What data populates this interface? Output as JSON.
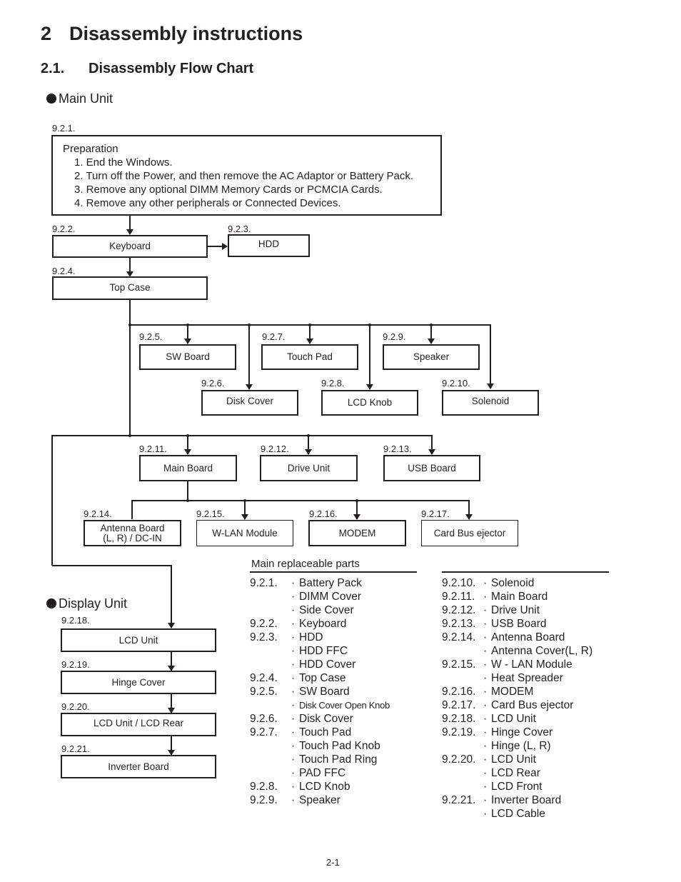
{
  "headings": {
    "chapter_number": "2",
    "chapter_title": "Disassembly instructions",
    "section_number": "2.1.",
    "section_title": "Disassembly Flow Chart",
    "main_unit": "Main Unit",
    "display_unit": "Display Unit"
  },
  "preparation": {
    "ref": "9.2.1.",
    "title": "Preparation",
    "steps": [
      "1. End the Windows.",
      "2. Turn off the Power, and then remove the AC Adaptor or Battery Pack.",
      "3. Remove any optional DIMM Memory Cards or PCMCIA Cards.",
      "4. Remove any other peripherals or Connected Devices."
    ]
  },
  "flow_nodes": [
    {
      "ref": "9.2.2.",
      "label": "Keyboard"
    },
    {
      "ref": "9.2.3.",
      "label": "HDD"
    },
    {
      "ref": "9.2.4.",
      "label": "Top Case"
    },
    {
      "ref": "9.2.5.",
      "label": "SW Board"
    },
    {
      "ref": "9.2.6.",
      "label": "Disk Cover"
    },
    {
      "ref": "9.2.7.",
      "label": "Touch Pad"
    },
    {
      "ref": "9.2.8.",
      "label": "LCD Knob"
    },
    {
      "ref": "9.2.9.",
      "label": "Speaker"
    },
    {
      "ref": "9.2.10.",
      "label": "Solenoid"
    },
    {
      "ref": "9.2.11.",
      "label": "Main Board"
    },
    {
      "ref": "9.2.12.",
      "label": "Drive Unit"
    },
    {
      "ref": "9.2.13.",
      "label": "USB Board"
    },
    {
      "ref": "9.2.14.",
      "label": "Antenna Board",
      "label2": "(L, R) / DC-IN"
    },
    {
      "ref": "9.2.15.",
      "label": "W-LAN Module"
    },
    {
      "ref": "9.2.16.",
      "label": "MODEM"
    },
    {
      "ref": "9.2.17.",
      "label": "Card Bus ejector"
    },
    {
      "ref": "9.2.18.",
      "label": "LCD Unit"
    },
    {
      "ref": "9.2.19.",
      "label": "Hinge Cover"
    },
    {
      "ref": "9.2.20.",
      "label": "LCD Unit / LCD Rear"
    },
    {
      "ref": "9.2.21.",
      "label": "Inverter Board"
    }
  ],
  "parts": {
    "heading": "Main replaceable parts",
    "bullet": "·",
    "left": [
      {
        "ref": "9.2.1.",
        "name": "Battery Pack"
      },
      {
        "ref": "",
        "name": "DIMM Cover"
      },
      {
        "ref": "",
        "name": "Side Cover"
      },
      {
        "ref": "9.2.2.",
        "name": "Keyboard"
      },
      {
        "ref": "9.2.3.",
        "name": "HDD"
      },
      {
        "ref": "",
        "name": "HDD FFC"
      },
      {
        "ref": "",
        "name": "HDD Cover"
      },
      {
        "ref": "9.2.4.",
        "name": "Top Case"
      },
      {
        "ref": "9.2.5.",
        "name": "SW Board"
      },
      {
        "ref": "",
        "name": "Disk Cover Open Knob",
        "small": true
      },
      {
        "ref": "9.2.6.",
        "name": "Disk Cover"
      },
      {
        "ref": "9.2.7.",
        "name": "Touch Pad"
      },
      {
        "ref": "",
        "name": "Touch Pad Knob"
      },
      {
        "ref": "",
        "name": "Touch Pad Ring"
      },
      {
        "ref": "",
        "name": "PAD FFC"
      },
      {
        "ref": "9.2.8.",
        "name": "LCD Knob"
      },
      {
        "ref": "9.2.9.",
        "name": "Speaker"
      }
    ],
    "right": [
      {
        "ref": "9.2.10.",
        "name": "Solenoid"
      },
      {
        "ref": "9.2.11.",
        "name": "Main Board"
      },
      {
        "ref": "9.2.12.",
        "name": "Drive Unit"
      },
      {
        "ref": "9.2.13.",
        "name": "USB Board"
      },
      {
        "ref": "9.2.14.",
        "name": "Antenna Board"
      },
      {
        "ref": "",
        "name": "Antenna Cover(L, R)"
      },
      {
        "ref": "9.2.15.",
        "name": "W - LAN Module"
      },
      {
        "ref": "",
        "name": "Heat Spreader"
      },
      {
        "ref": "9.2.16.",
        "name": "MODEM"
      },
      {
        "ref": "9.2.17.",
        "name": "Card Bus ejector"
      },
      {
        "ref": "9.2.18.",
        "name": "LCD Unit"
      },
      {
        "ref": "9.2.19.",
        "name": "Hinge Cover"
      },
      {
        "ref": "",
        "name": "Hinge (L, R)"
      },
      {
        "ref": "9.2.20.",
        "name": "LCD Unit"
      },
      {
        "ref": "",
        "name": "LCD Rear"
      },
      {
        "ref": "",
        "name": "LCD Front"
      },
      {
        "ref": "9.2.21.",
        "name": "Inverter Board"
      },
      {
        "ref": "",
        "name": "LCD Cable"
      }
    ]
  },
  "footer": {
    "page_number": "2-1"
  }
}
